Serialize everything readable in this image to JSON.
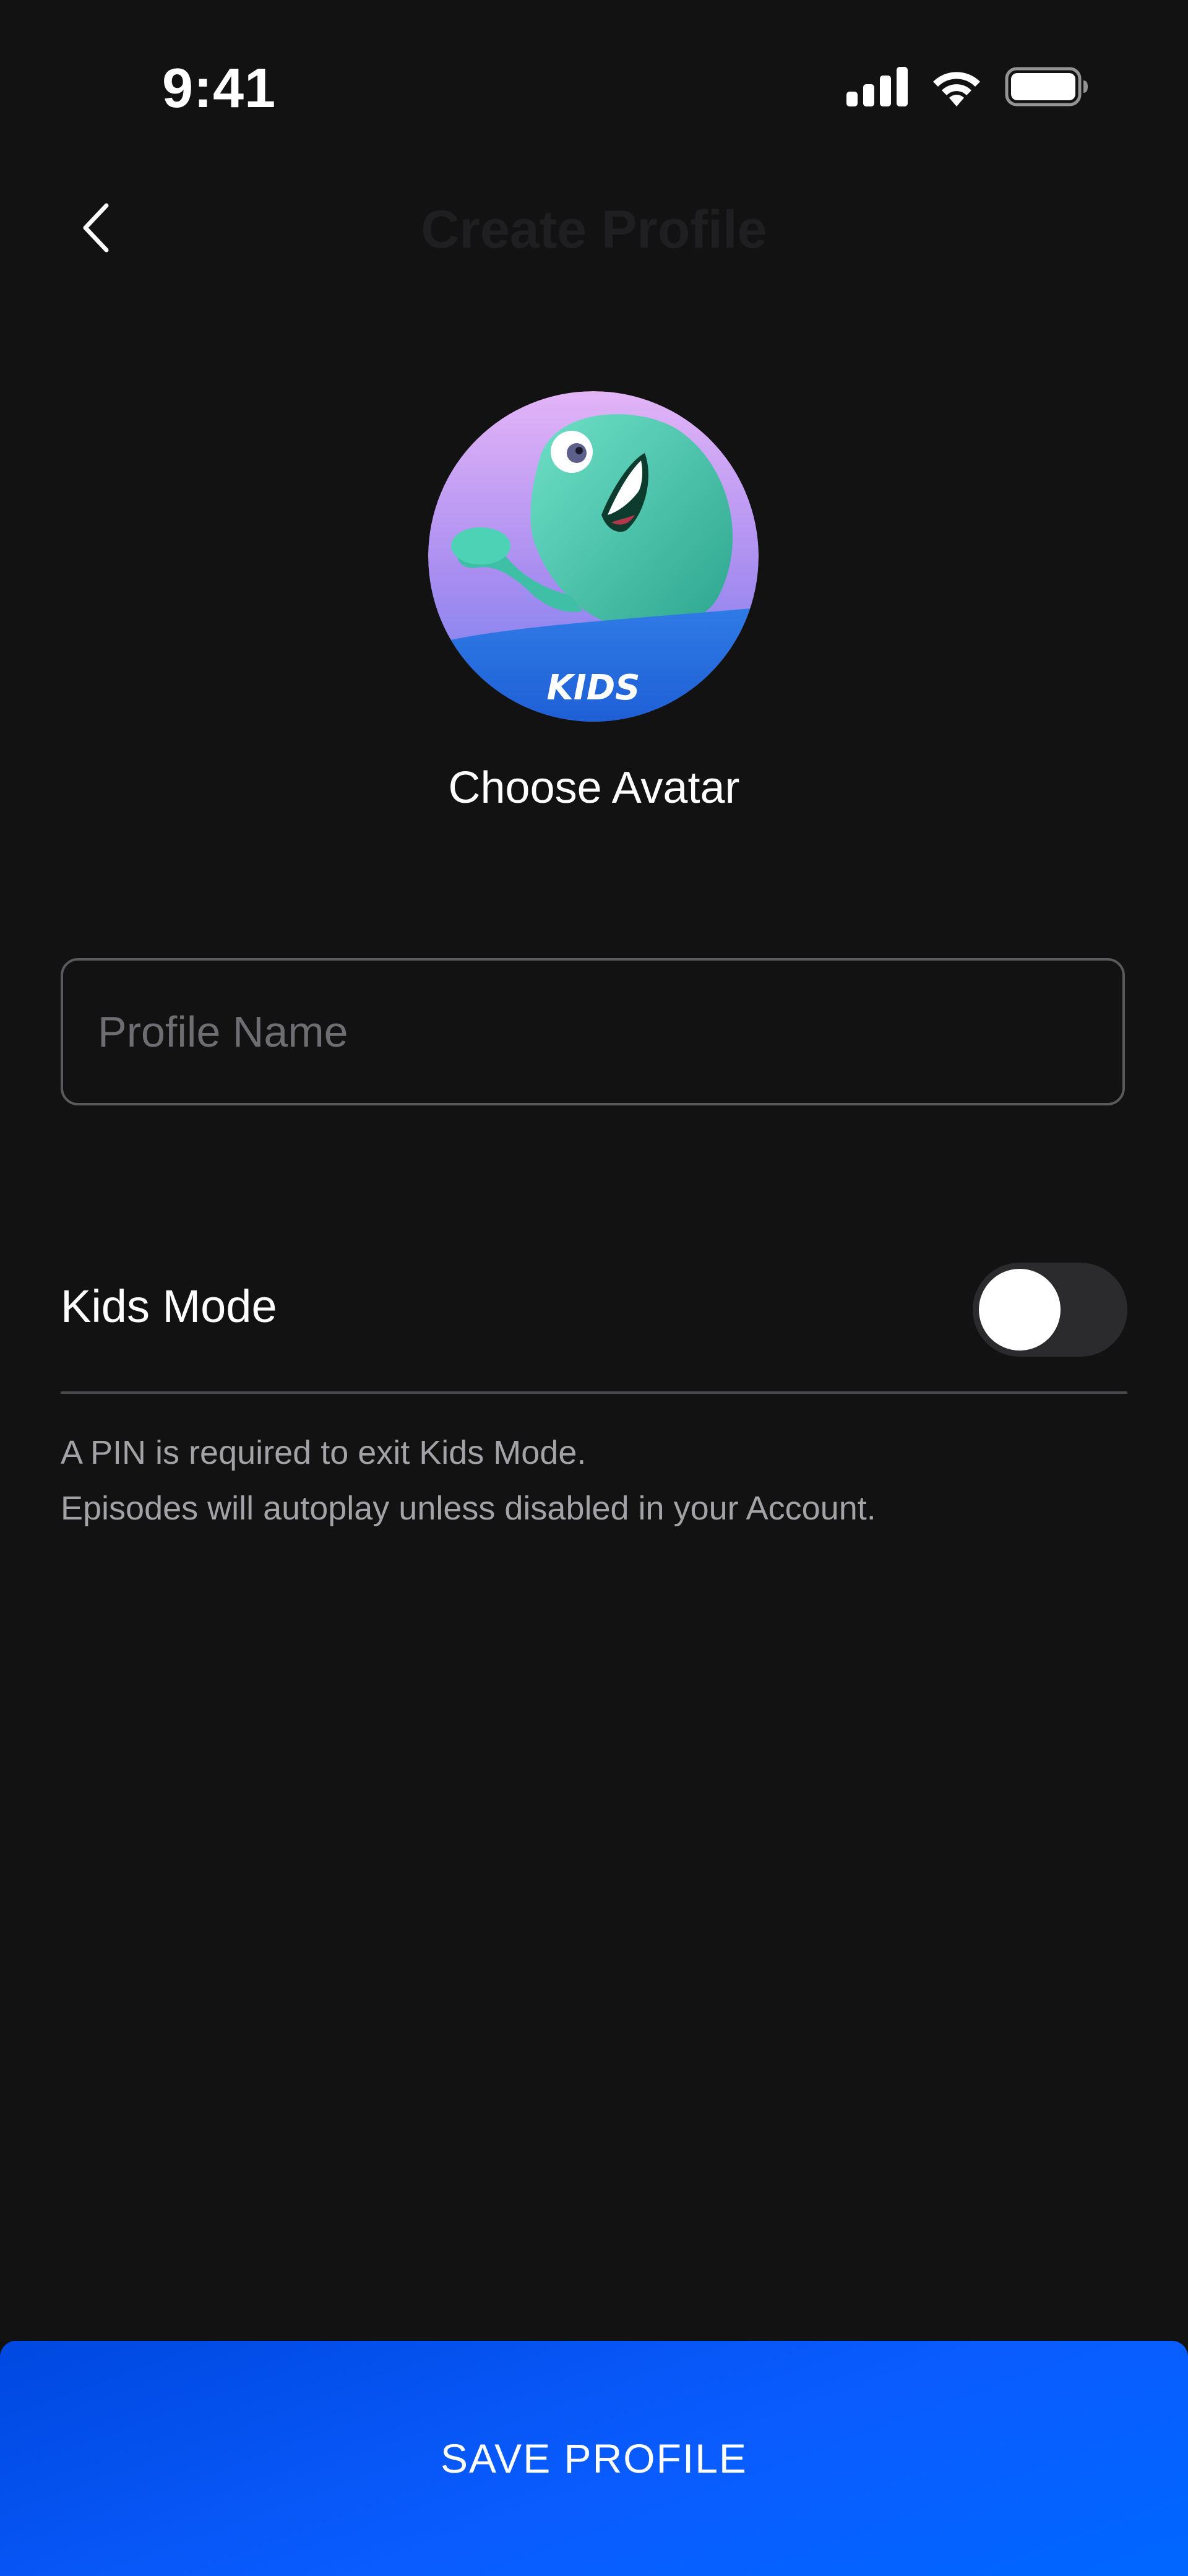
{
  "status_bar": {
    "time": "9:41",
    "icons": [
      "signal-icon",
      "wifi-icon",
      "battery-icon"
    ]
  },
  "header": {
    "title": "Create Profile",
    "back_icon": "chevron-left-icon"
  },
  "avatar": {
    "badge_text": "KIDS",
    "choose_label": "Choose Avatar"
  },
  "form": {
    "profile_name_value": "",
    "profile_name_placeholder": "Profile Name"
  },
  "kids_mode": {
    "label": "Kids Mode",
    "enabled": false,
    "info_line_1": "A PIN is required to exit Kids Mode.",
    "info_line_2": "Episodes will autoplay unless disabled in your Account."
  },
  "footer": {
    "save_label": "SAVE PROFILE"
  },
  "colors": {
    "background": "#121213",
    "accent": "#0a5cff",
    "title_dim": "#1f1f21",
    "muted_text": "#a3a3a7"
  }
}
